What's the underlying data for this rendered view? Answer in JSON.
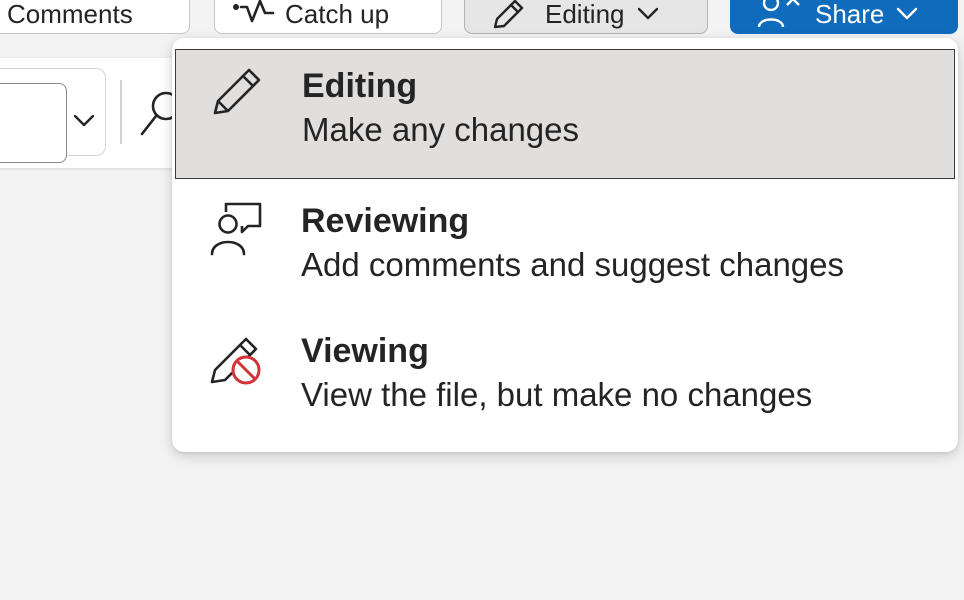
{
  "toolbar": {
    "comments_label": "Comments",
    "catchup_label": "Catch up",
    "editing_label": "Editing",
    "share_label": "Share",
    "icons": {
      "catchup": "catch-up-pulse-icon",
      "editing": "pencil-icon",
      "share": "people-share-icon",
      "chevron": "chevron-down-icon"
    }
  },
  "ribbon": {
    "font_size_value": "",
    "icons": {
      "dropdown": "chevron-down-icon",
      "search": "search-icon"
    }
  },
  "mode_menu": {
    "selected": "Editing",
    "items": [
      {
        "title": "Editing",
        "description": "Make any changes",
        "icon": "pencil-icon"
      },
      {
        "title": "Reviewing",
        "description": "Add comments and suggest changes",
        "icon": "person-comment-icon"
      },
      {
        "title": "Viewing",
        "description": "View the file, but make no changes",
        "icon": "pencil-prohibited-icon"
      }
    ]
  },
  "colors": {
    "share_blue": "#0f6cbd",
    "selected_bg": "#e0dfde",
    "prohibited_red": "#d13438",
    "text": "#242424"
  }
}
